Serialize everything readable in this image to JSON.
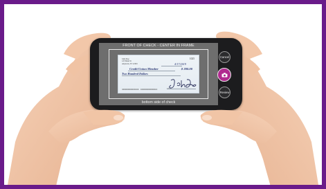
{
  "camera": {
    "header_text": "FRONT OF CHECK - CENTER IN FRAME",
    "footer_text": "bottom side of check",
    "cancel_label": "Cancel",
    "review_label": "Review",
    "shutter_icon": "camera-icon"
  },
  "check": {
    "owner_lines": [
      "John Doe",
      "123 Main St",
      "Anytown, ST 12345"
    ],
    "check_number": "1025",
    "date": "4/17/2019",
    "payee": "Credit Union Member",
    "amount": "$ 200.00",
    "amount_words": "Two Hundred Dollars",
    "micr": "400000000004  400000000004",
    "memo": "1215",
    "signature": "John Doe"
  },
  "colors": {
    "frame_border": "#6a1b8a",
    "shutter": "#b02a8f",
    "ink": "#23306e"
  }
}
